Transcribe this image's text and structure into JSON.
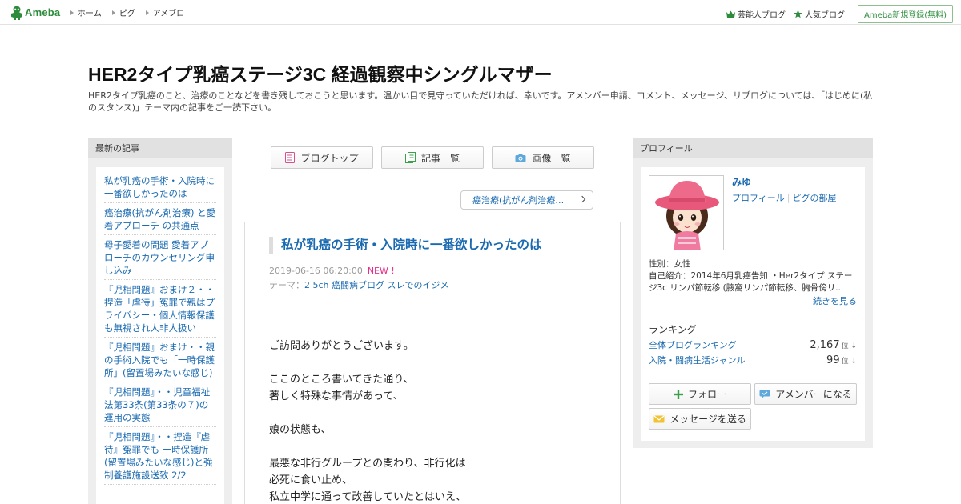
{
  "topbar": {
    "logo_text": "Ameba",
    "nav": [
      "ホーム",
      "ピグ",
      "アメブロ"
    ],
    "right_links": [
      "芸能人ブログ",
      "人気ブログ"
    ],
    "signup_label": "Ameba新規登録(無料)"
  },
  "header": {
    "title": "HER2タイプ乳癌ステージ3C 経過観察中シングルマザー",
    "description": "HER2タイプ乳癌のこと、治療のことなどを書き残しておこうと思います。温かい目で見守っていただければ、幸いです。アメンバー申請、コメント、メッセージ、リブログについては、「はじめに(私のスタンス)」テーマ内の記事をご一読下さい。"
  },
  "left": {
    "title": "最新の記事",
    "items": [
      "私が乳癌の手術・入院時に一番欲しかったのは",
      "癌治療(抗がん剤治療) と愛着アプローチ の共通点",
      "母子愛着の問題 愛着アプローチのカウンセリング申し込み",
      "『児相問題』おまけ２・・捏造「虐待」冤罪で親はプライバシー・個人情報保護も無視され人非人扱い",
      "『児相問題』おまけ・・親の手術入院でも「一時保護所」(留置場みたいな感じ)",
      "『児相問題』・・児童福祉法第33条(第33条の７)の運用の実態",
      "『児相問題』・・捏造『虐待』冤罪でも 一時保護所(留置場みたいな感じ)と強制養護施設送致 2/2"
    ]
  },
  "center": {
    "buttons": [
      "ブログトップ",
      "記事一覧",
      "画像一覧"
    ],
    "theme_pill": "癌治療(抗がん剤治療…",
    "entry": {
      "title": "私が乳癌の手術・入院時に一番欲しかったのは",
      "date": "2019-06-16 06:20:00",
      "new_badge": "NEW !",
      "theme_prefix": "テーマ：",
      "theme": "2 5ch 癌闘病ブログ スレでのイジメ",
      "body": [
        "ご訪問ありがとうございます。",
        "ここのところ書いてきた通り、\n著しく特殊な事情があって、",
        "娘の状態も、",
        "最悪な非行グループとの関わり、非行化は\n必死に食い止め、\n私立中学に通って改善していたとはいえ、"
      ]
    }
  },
  "right": {
    "title": "プロフィール",
    "name": "みゆ",
    "links": [
      "プロフィール",
      "ピグの部屋"
    ],
    "gender": "性別：女性",
    "intro": "自己紹介：2014年6月乳癌告知 ・Her2タイプ ステージ3c リンパ節転移 (腋窩リンパ節転移、胸骨傍リ...",
    "more": "続きを見る",
    "ranking_title": "ランキング",
    "rankings": [
      {
        "label": "全体ブログランキング",
        "value": "2,167",
        "unit": "位 ↓"
      },
      {
        "label": "入院・闘病生活ジャンル",
        "value": "99",
        "unit": "位 ↓"
      }
    ],
    "buttons": [
      "フォロー",
      "アメンバーになる",
      "メッセージを送る"
    ]
  }
}
